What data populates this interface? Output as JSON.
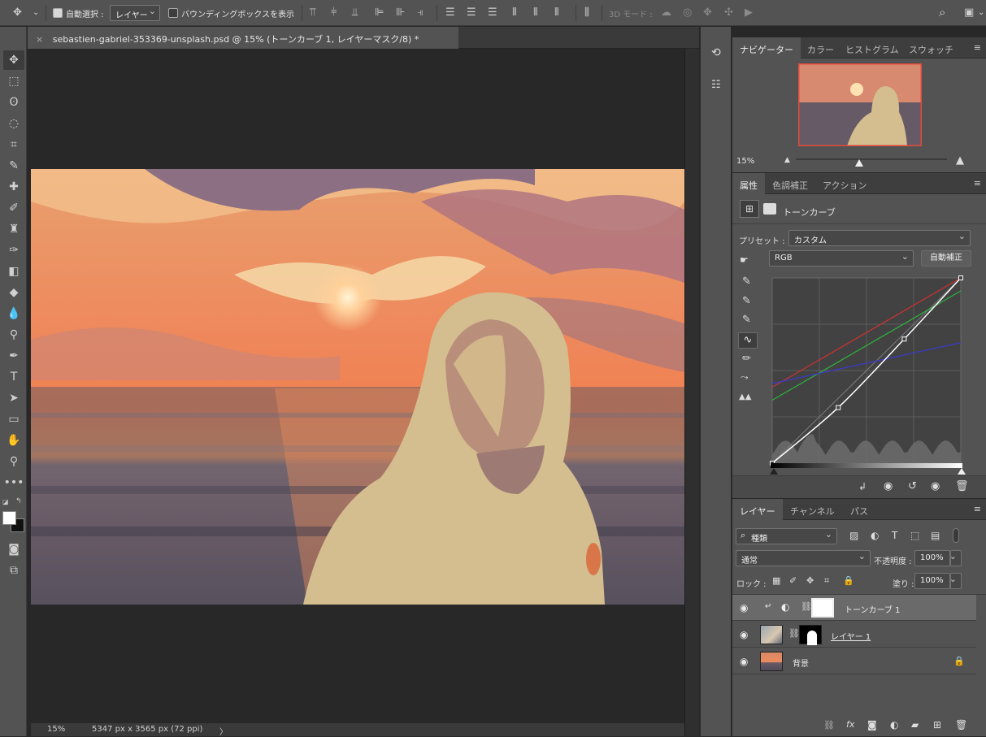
{
  "options_bar": {
    "auto_select_label": "自動選択 :",
    "auto_select_value": "レイヤー",
    "bounding_box_label": "バウンディングボックスを表示",
    "mode_3d_label": "3D モード :"
  },
  "document": {
    "tab_title": "sebastien-gabriel-353369-unsplash.psd @ 15% (トーンカーブ 1, レイヤーマスク/8) *",
    "status_zoom": "15%",
    "status_info": "5347 px x 3565 px (72 ppi)",
    "status_arrow": "〉"
  },
  "navigator": {
    "tabs": [
      "ナビゲーター",
      "カラー",
      "ヒストグラム",
      "スウォッチ"
    ],
    "zoom": "15%",
    "zoom_fraction": 0.42
  },
  "properties": {
    "tabs": [
      "属性",
      "色調補正",
      "アクション"
    ],
    "panel_title": "トーンカーブ",
    "preset_label": "プリセット :",
    "preset_value": "カスタム",
    "channel_value": "RGB",
    "auto_button": "自動補正",
    "curves": {
      "rgb": [
        [
          0,
          0
        ],
        [
          0.35,
          0.3
        ],
        [
          0.7,
          0.67
        ],
        [
          1,
          1
        ]
      ],
      "red": [
        [
          0,
          0.41
        ],
        [
          1,
          1
        ]
      ],
      "green": [
        [
          0,
          0.34
        ],
        [
          1,
          0.93
        ]
      ],
      "blue": [
        [
          0,
          0.43
        ],
        [
          1,
          0.65
        ]
      ]
    }
  },
  "layers": {
    "tabs": [
      "レイヤー",
      "チャンネル",
      "パス"
    ],
    "filter_value": "種類",
    "blend_mode": "通常",
    "opacity_label": "不透明度 :",
    "opacity_value": "100%",
    "lock_label": "ロック :",
    "fill_label": "塗り :",
    "fill_value": "100%",
    "items": [
      {
        "name": "トーンカーブ 1"
      },
      {
        "name": "レイヤー 1"
      },
      {
        "name": "背景"
      }
    ]
  },
  "colors": {
    "panel": "#535353",
    "accent": "#e24a3a",
    "red_curve": "#c83232",
    "green_curve": "#2fae3f",
    "blue_curve": "#3a3ac8"
  }
}
